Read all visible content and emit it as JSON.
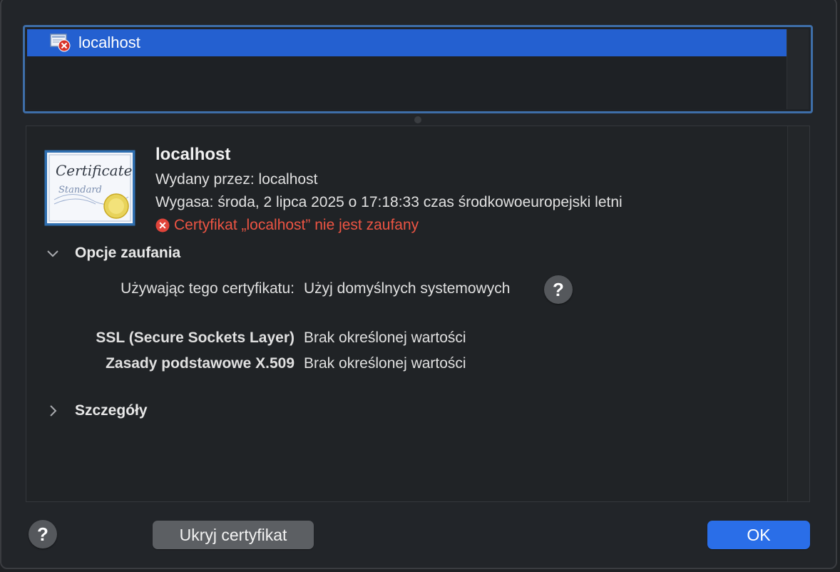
{
  "cert_list": {
    "items": [
      {
        "label": "localhost",
        "selected": true,
        "icon": "untrusted-certificate-icon"
      }
    ]
  },
  "certificate": {
    "badge_text_1": "Certificate",
    "badge_text_2": "Standard",
    "name": "localhost",
    "issuer": "Wydany przez: localhost",
    "expiry": "Wygasa: środa, 2 lipca 2025 o 17:18:33 czas środkowoeuropejski letni",
    "warning": "Certyfikat „localhost” nie jest zaufany",
    "warning_color": "#ec5443"
  },
  "trust": {
    "header": "Opcje zaufania",
    "expanded": true,
    "using_label": "Używając tego certyfikatu:",
    "using_value": "Użyj domyślnych systemowych",
    "ssl_label": "SSL (Secure Sockets Layer)",
    "ssl_value": "Brak określonej wartości",
    "x509_label": "Zasady podstawowe X.509",
    "x509_value": "Brak określonej wartości"
  },
  "details": {
    "header": "Szczegóły",
    "expanded": false
  },
  "footer": {
    "help_label": "?",
    "hide_button": "Ukryj certyfikat",
    "ok_button": "OK",
    "accent": "#2a6ee8"
  }
}
